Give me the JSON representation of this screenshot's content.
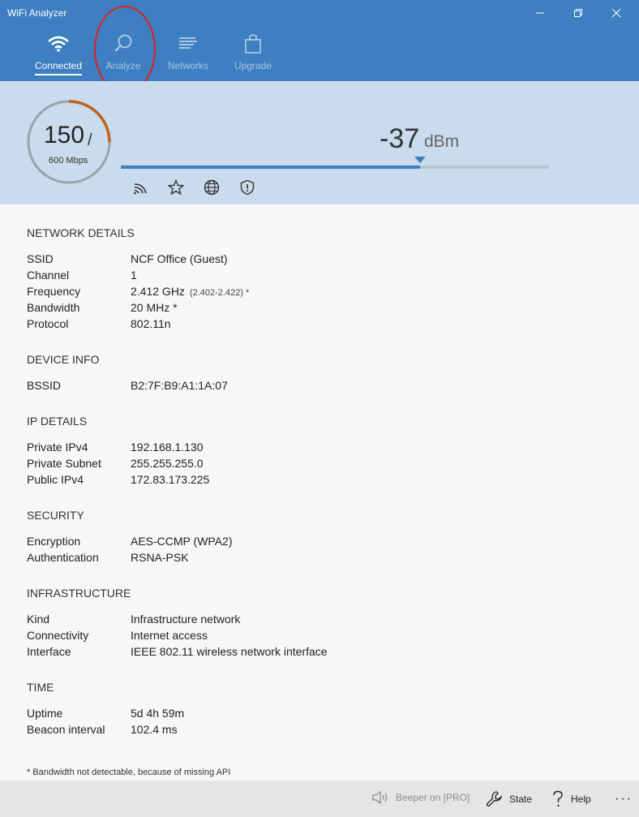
{
  "window": {
    "title": "WiFi Analyzer",
    "minimize_icon": "minimize-icon",
    "restore_icon": "restore-icon",
    "close_icon": "close-icon"
  },
  "nav": {
    "items": [
      {
        "label": "Connected",
        "icon": "wifi-icon",
        "active": true
      },
      {
        "label": "Analyze",
        "icon": "analyze-icon",
        "active": false
      },
      {
        "label": "Networks",
        "icon": "networks-icon",
        "active": false
      },
      {
        "label": "Upgrade",
        "icon": "shopping-bag-icon",
        "active": false
      }
    ]
  },
  "signal": {
    "speed": "150",
    "slash": "/",
    "max_speed": "600 Mbps",
    "speed_fraction": 0.25,
    "dbm_value": "-37",
    "dbm_unit": "dBm",
    "strength_fraction": 0.698,
    "icons": [
      "signal-icon",
      "star-icon",
      "globe-icon",
      "shield-icon"
    ]
  },
  "sections": {
    "network": {
      "title": "NETWORK DETAILS",
      "rows": [
        {
          "label": "SSID",
          "value": "NCF Office (Guest)"
        },
        {
          "label": "Channel",
          "value": "1"
        },
        {
          "label": "Frequency",
          "value": "2.412 GHz",
          "sub": "(2.402-2.422) *"
        },
        {
          "label": "Bandwidth",
          "value": "20 MHz *"
        },
        {
          "label": "Protocol",
          "value": "802.11n"
        }
      ]
    },
    "device": {
      "title": "DEVICE INFO",
      "rows": [
        {
          "label": "BSSID",
          "value": "B2:7F:B9:A1:1A:07"
        }
      ]
    },
    "ip": {
      "title": "IP DETAILS",
      "rows": [
        {
          "label": "Private IPv4",
          "value": "192.168.1.130"
        },
        {
          "label": "Private Subnet",
          "value": "255.255.255.0"
        },
        {
          "label": "Public IPv4",
          "value": "172.83.173.225"
        }
      ]
    },
    "security": {
      "title": "SECURITY",
      "rows": [
        {
          "label": "Encryption",
          "value": "AES-CCMP (WPA2)"
        },
        {
          "label": "Authentication",
          "value": "RSNA-PSK"
        }
      ]
    },
    "infrastructure": {
      "title": "INFRASTRUCTURE",
      "rows": [
        {
          "label": "Kind",
          "value": "Infrastructure network"
        },
        {
          "label": "Connectivity",
          "value": "Internet access"
        },
        {
          "label": "Interface",
          "value": "IEEE 802.11 wireless network interface"
        }
      ]
    },
    "time": {
      "title": "TIME",
      "rows": [
        {
          "label": "Uptime",
          "value": "5d 4h 59m"
        },
        {
          "label": "Beacon interval",
          "value": "102.4 ms"
        }
      ]
    }
  },
  "footnote": "* Bandwidth not detectable, because of missing API",
  "bottombar": {
    "beeper": "Beeper on [PRO]",
    "state": "State",
    "help": "Help",
    "more": "···"
  },
  "colors": {
    "accent": "#3d7fc1",
    "gauge_arc": "#c0601a",
    "annotation": "#e02020"
  }
}
